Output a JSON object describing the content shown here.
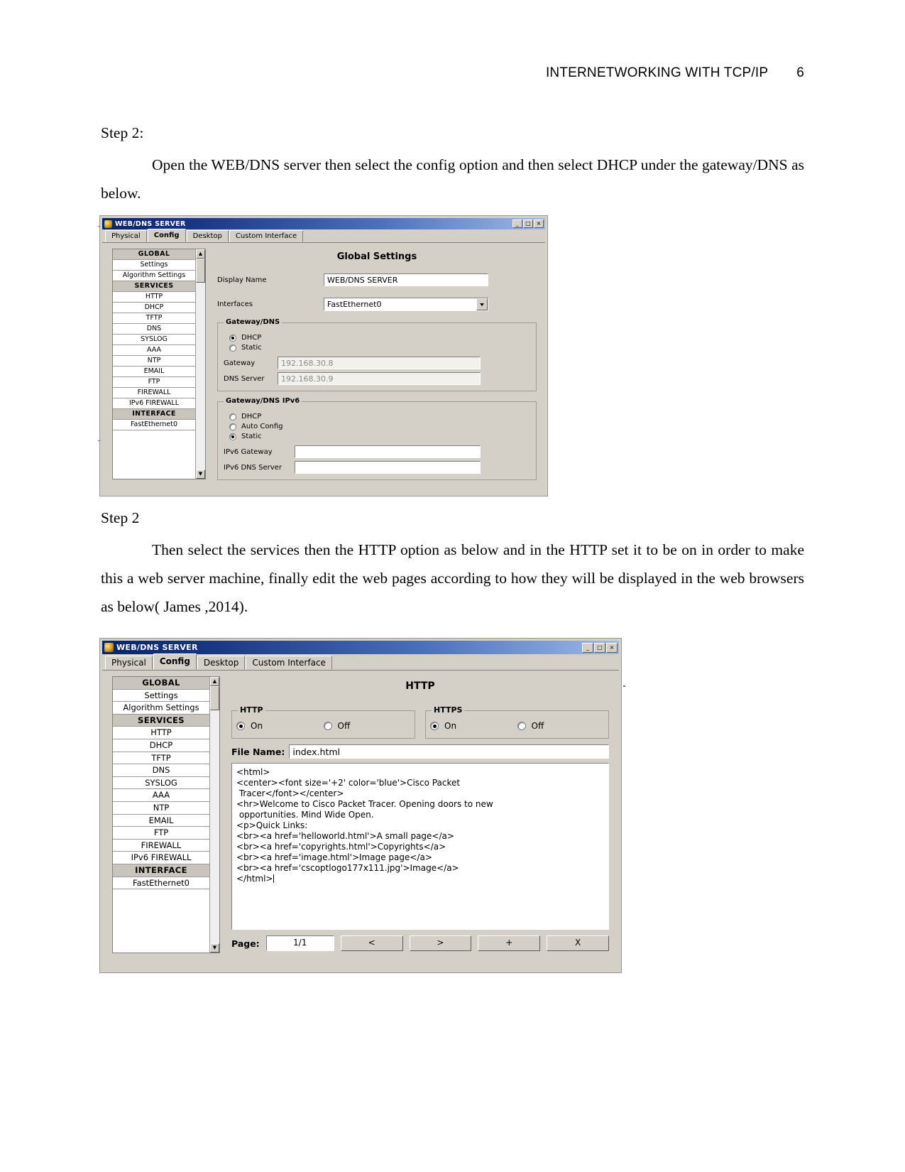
{
  "header": {
    "title": "INTERNETWORKING WITH TCP/IP",
    "page_number": "6"
  },
  "document": {
    "step2_label": "Step 2:",
    "step2_paragraph": "Open the WEB/DNS server then select the config option and then select DHCP under the gateway/DNS as below.",
    "step2b_label": "Step 2",
    "step2b_paragraph": "Then select the services then the HTTP option as below and in the HTTP set it to be on in order to make this a web server machine, finally edit the web pages according to how they will be displayed in the web browsers as below( James ,2014)."
  },
  "window1": {
    "title": "WEB/DNS SERVER",
    "icon": "packet-tracer-icon",
    "buttons": {
      "minimize": "_",
      "maximize": "□",
      "close": "×"
    },
    "tabs": [
      {
        "label": "Physical",
        "active": false
      },
      {
        "label": "Config",
        "active": true
      },
      {
        "label": "Desktop",
        "active": false
      },
      {
        "label": "Custom Interface",
        "active": false
      }
    ],
    "nav_items": [
      {
        "label": "GLOBAL",
        "type": "header"
      },
      {
        "label": "Settings",
        "type": "item"
      },
      {
        "label": "Algorithm Settings",
        "type": "item"
      },
      {
        "label": "SERVICES",
        "type": "header"
      },
      {
        "label": "HTTP",
        "type": "item"
      },
      {
        "label": "DHCP",
        "type": "item"
      },
      {
        "label": "TFTP",
        "type": "item"
      },
      {
        "label": "DNS",
        "type": "item"
      },
      {
        "label": "SYSLOG",
        "type": "item"
      },
      {
        "label": "AAA",
        "type": "item"
      },
      {
        "label": "NTP",
        "type": "item"
      },
      {
        "label": "EMAIL",
        "type": "item"
      },
      {
        "label": "FTP",
        "type": "item"
      },
      {
        "label": "FIREWALL",
        "type": "item"
      },
      {
        "label": "IPv6 FIREWALL",
        "type": "item"
      },
      {
        "label": "INTERFACE",
        "type": "header"
      },
      {
        "label": "FastEthernet0",
        "type": "item"
      }
    ],
    "pane_title": "Global Settings",
    "display_name_label": "Display Name",
    "display_name_value": "WEB/DNS SERVER",
    "interfaces_label": "Interfaces",
    "interfaces_value": "FastEthernet0",
    "gateway_dns": {
      "legend": "Gateway/DNS",
      "dhcp_label": "DHCP",
      "dhcp_selected": true,
      "static_label": "Static",
      "static_selected": false,
      "gateway_label": "Gateway",
      "gateway_value": "192.168.30.8",
      "dns_label": "DNS Server",
      "dns_value": "192.168.30.9"
    },
    "gateway_dns_ipv6": {
      "legend": "Gateway/DNS IPv6",
      "dhcp_label": "DHCP",
      "dhcp_selected": false,
      "auto_label": "Auto Config",
      "auto_selected": false,
      "static_label": "Static",
      "static_selected": true,
      "ipv6_gateway_label": "IPv6 Gateway",
      "ipv6_gateway_value": "",
      "ipv6_dns_label": "IPv6 DNS Server",
      "ipv6_dns_value": ""
    }
  },
  "window2": {
    "title": "WEB/DNS SERVER",
    "icon": "packet-tracer-icon",
    "buttons": {
      "minimize": "_",
      "maximize": "□",
      "close": "×"
    },
    "tabs": [
      {
        "label": "Physical",
        "active": false
      },
      {
        "label": "Config",
        "active": true
      },
      {
        "label": "Desktop",
        "active": false
      },
      {
        "label": "Custom Interface",
        "active": false
      }
    ],
    "nav_items": [
      {
        "label": "GLOBAL",
        "type": "header"
      },
      {
        "label": "Settings",
        "type": "item"
      },
      {
        "label": "Algorithm Settings",
        "type": "item"
      },
      {
        "label": "SERVICES",
        "type": "header"
      },
      {
        "label": "HTTP",
        "type": "item"
      },
      {
        "label": "DHCP",
        "type": "item"
      },
      {
        "label": "TFTP",
        "type": "item"
      },
      {
        "label": "DNS",
        "type": "item"
      },
      {
        "label": "SYSLOG",
        "type": "item"
      },
      {
        "label": "AAA",
        "type": "item"
      },
      {
        "label": "NTP",
        "type": "item"
      },
      {
        "label": "EMAIL",
        "type": "item"
      },
      {
        "label": "FTP",
        "type": "item"
      },
      {
        "label": "FIREWALL",
        "type": "item"
      },
      {
        "label": "IPv6 FIREWALL",
        "type": "item"
      },
      {
        "label": "INTERFACE",
        "type": "header"
      },
      {
        "label": "FastEthernet0",
        "type": "item"
      }
    ],
    "pane_title": "HTTP",
    "http_group": {
      "legend": "HTTP",
      "on_label": "On",
      "off_label": "Off",
      "selected": "On"
    },
    "https_group": {
      "legend": "HTTPS",
      "on_label": "On",
      "off_label": "Off",
      "selected": "On"
    },
    "file_name_label": "File Name:",
    "file_name_value": "index.html",
    "code": "<html>\n<center><font size='+2' color='blue'>Cisco Packet\n Tracer</font></center>\n<hr>Welcome to Cisco Packet Tracer. Opening doors to new\n opportunities. Mind Wide Open.\n<p>Quick Links:\n<br><a href='helloworld.html'>A small page</a>\n<br><a href='copyrights.html'>Copyrights</a>\n<br><a href='image.html'>Image page</a>\n<br><a href='cscoptlogo177x111.jpg'>Image</a>\n</html>",
    "page_label": "Page:",
    "page_value": "1/1",
    "nav_buttons": [
      {
        "label": "<",
        "name": "prev-page-button"
      },
      {
        "label": ">",
        "name": "next-page-button"
      },
      {
        "label": "+",
        "name": "add-page-button"
      },
      {
        "label": "X",
        "name": "delete-page-button"
      }
    ]
  }
}
